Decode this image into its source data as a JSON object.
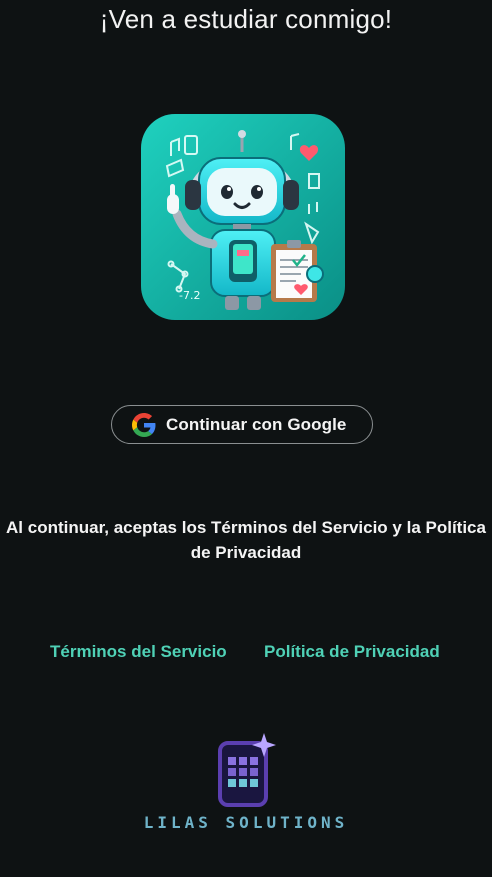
{
  "header": {
    "title": "¡Ven a estudiar conmigo!"
  },
  "hero": {
    "image_icon": "robot-student-mascot"
  },
  "auth": {
    "google_button_label": "Continuar con Google",
    "google_icon": "google-g-icon"
  },
  "legal": {
    "notice": "Al continuar, aceptas los Términos del Servicio y la Política de Privacidad",
    "terms_link": "Términos del Servicio",
    "privacy_link": "Política de Privacidad"
  },
  "footer": {
    "brand_name": "LILAS SOLUTIONS",
    "brand_icon": "lilas-phone-grid-sparkle-logo"
  },
  "colors": {
    "background": "#0e1213",
    "link": "#4fd1b6",
    "brand_text": "#6fb3c9",
    "brand_purple": "#5b3fb0",
    "hero_teal": "#12b9a8"
  }
}
